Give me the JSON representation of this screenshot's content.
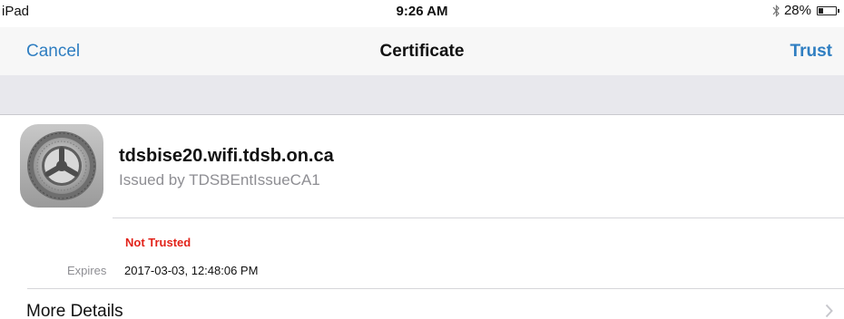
{
  "status_bar": {
    "device": "iPad",
    "time": "9:26 AM",
    "battery": "28%"
  },
  "nav": {
    "cancel_label": "Cancel",
    "title": "Certificate",
    "trust_label": "Trust"
  },
  "certificate": {
    "name": "tdsbise20.wifi.tdsb.on.ca",
    "issuer": "Issued by TDSBEntIssueCA1",
    "icon": "settings-gear-icon",
    "trust_status": "Not Trusted",
    "expires_label": "Expires",
    "expires_value": "2017-03-03, 12:48:06 PM"
  },
  "more_details": {
    "label": "More Details"
  },
  "colors": {
    "accent": "#2f7ec1",
    "warning": "#e2231a",
    "secondary_text": "#8e8e93",
    "group_background": "#e8e8ed"
  }
}
